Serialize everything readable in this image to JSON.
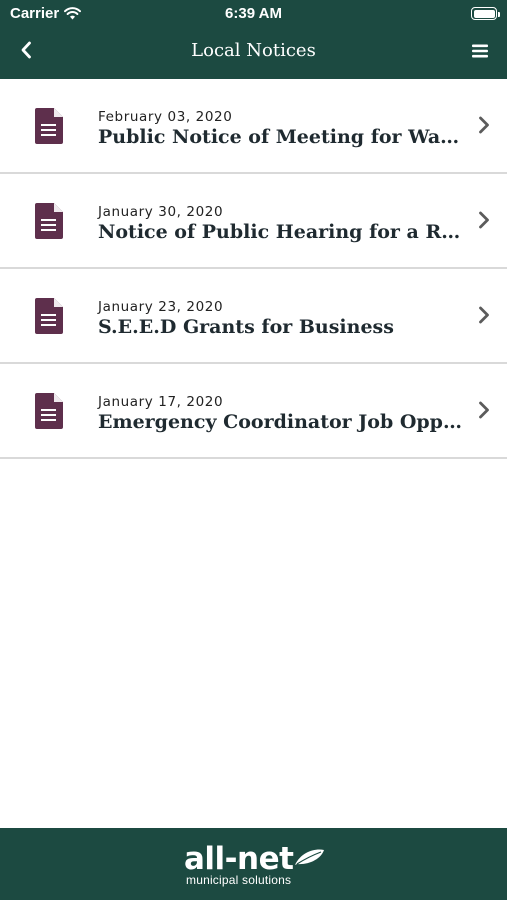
{
  "status_bar": {
    "carrier": "Carrier",
    "time": "6:39 AM",
    "wifi_icon": "wifi-icon",
    "battery_icon": "battery-full-icon"
  },
  "nav": {
    "title": "Local Notices",
    "back_icon": "chevron-left-icon",
    "menu_icon": "hamburger-menu-icon"
  },
  "notices": [
    {
      "date": "February 03, 2020",
      "title": "Public Notice of Meeting for Water ...",
      "icon": "document-icon",
      "chevron": "chevron-right-icon"
    },
    {
      "date": "January 30, 2020",
      "title": "Notice of Public Hearing for a Road ...",
      "icon": "document-icon",
      "chevron": "chevron-right-icon"
    },
    {
      "date": "January 23, 2020",
      "title": "S.E.E.D Grants for Business",
      "icon": "document-icon",
      "chevron": "chevron-right-icon"
    },
    {
      "date": "January 17, 2020",
      "title": "Emergency Coordinator Job Opport...",
      "icon": "document-icon",
      "chevron": "chevron-right-icon"
    }
  ],
  "footer": {
    "brand": "all-net",
    "tagline": "municipal solutions"
  },
  "colors": {
    "header_bg": "#1c4a41",
    "footer_bg": "#1c4a41",
    "document_icon": "#5e2f4c",
    "divider": "#d9d9d9",
    "chevron": "#5b5b5b"
  }
}
